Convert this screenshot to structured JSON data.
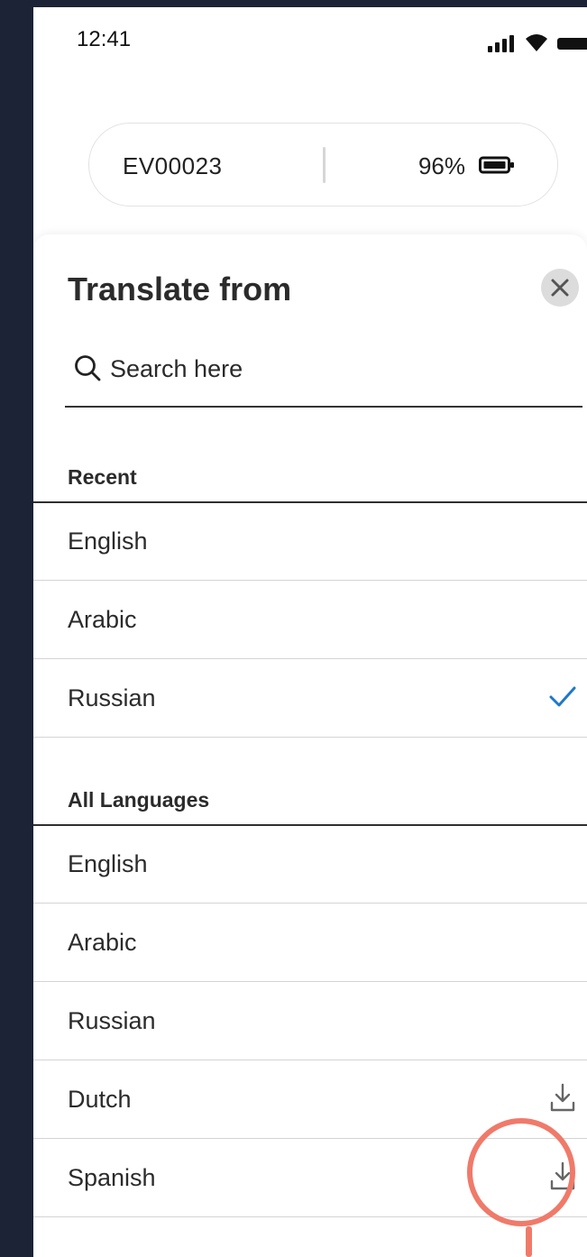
{
  "status_bar": {
    "time": "12:41"
  },
  "device": {
    "id": "EV00023",
    "battery_percent": "96%"
  },
  "sheet": {
    "title": "Translate from",
    "search_placeholder": "Search here",
    "recent_label": "Recent",
    "recent": [
      {
        "name": "English",
        "selected": false
      },
      {
        "name": "Arabic",
        "selected": false
      },
      {
        "name": "Russian",
        "selected": true
      }
    ],
    "all_label": "All Languages",
    "all": [
      {
        "name": "English",
        "downloadable": false
      },
      {
        "name": "Arabic",
        "downloadable": false
      },
      {
        "name": "Russian",
        "downloadable": false
      },
      {
        "name": "Dutch",
        "downloadable": true
      },
      {
        "name": "Spanish",
        "downloadable": true
      }
    ]
  },
  "colors": {
    "accent": "#1f78c8",
    "highlight": "#f07a6a",
    "background": "#1c2336"
  }
}
